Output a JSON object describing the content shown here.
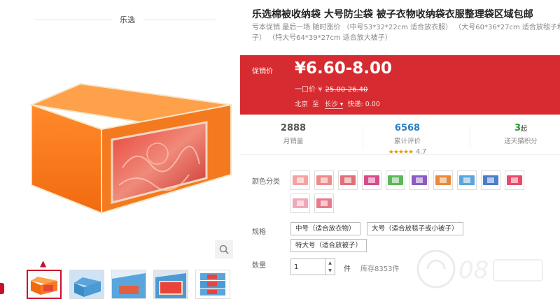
{
  "brand": "乐选",
  "product": {
    "title": "乐选棉被收纳袋 大号防尘袋 被子衣物收纳袋衣服整理袋区域包邮",
    "subtitle_line1": "亏本促销 最后一场 随时涨价 （中号53*32*22cm 适合放衣服） （大号60*36*27cm 适合放毯子和",
    "subtitle_line2": "子） （特大号64*39*27cm 适合放大被子）"
  },
  "promo": {
    "label": "促销价",
    "price": "¥6.60-8.00",
    "orig_label": "一口价 ¥",
    "orig_price": "25.00-26.40",
    "ship_from": "北京",
    "ship_to_label": "至",
    "ship_to": "长沙",
    "ship_fee": "快递: 0.00"
  },
  "stats": {
    "sales_num": "2888",
    "sales_label": "月销量",
    "reviews_num": "6568",
    "reviews_label": "累计评价",
    "stars": "★★★★★",
    "rating": "4.7",
    "points_num": "3",
    "points_unit": "起",
    "points_label": "送天猫积分"
  },
  "colors": {
    "label": "颜色分类",
    "swatches": [
      "#f4a3a3",
      "#f08a8a",
      "#e0707a",
      "#d84a8a",
      "#5cb85c",
      "#8a5cc0",
      "#e88a3a",
      "#5aa6dc",
      "#4a7ec8",
      "#e84a6a",
      "#f0a8b8",
      "#e87a8a"
    ]
  },
  "spec": {
    "label": "规格",
    "options": [
      "中号（适合放衣物）",
      "大号（适合放毯子或小被子）",
      "特大号（适合放被子）"
    ]
  },
  "qty": {
    "label": "数量",
    "value": "1",
    "unit": "件",
    "stock": "库存8353件"
  },
  "accent": "#d62b30"
}
